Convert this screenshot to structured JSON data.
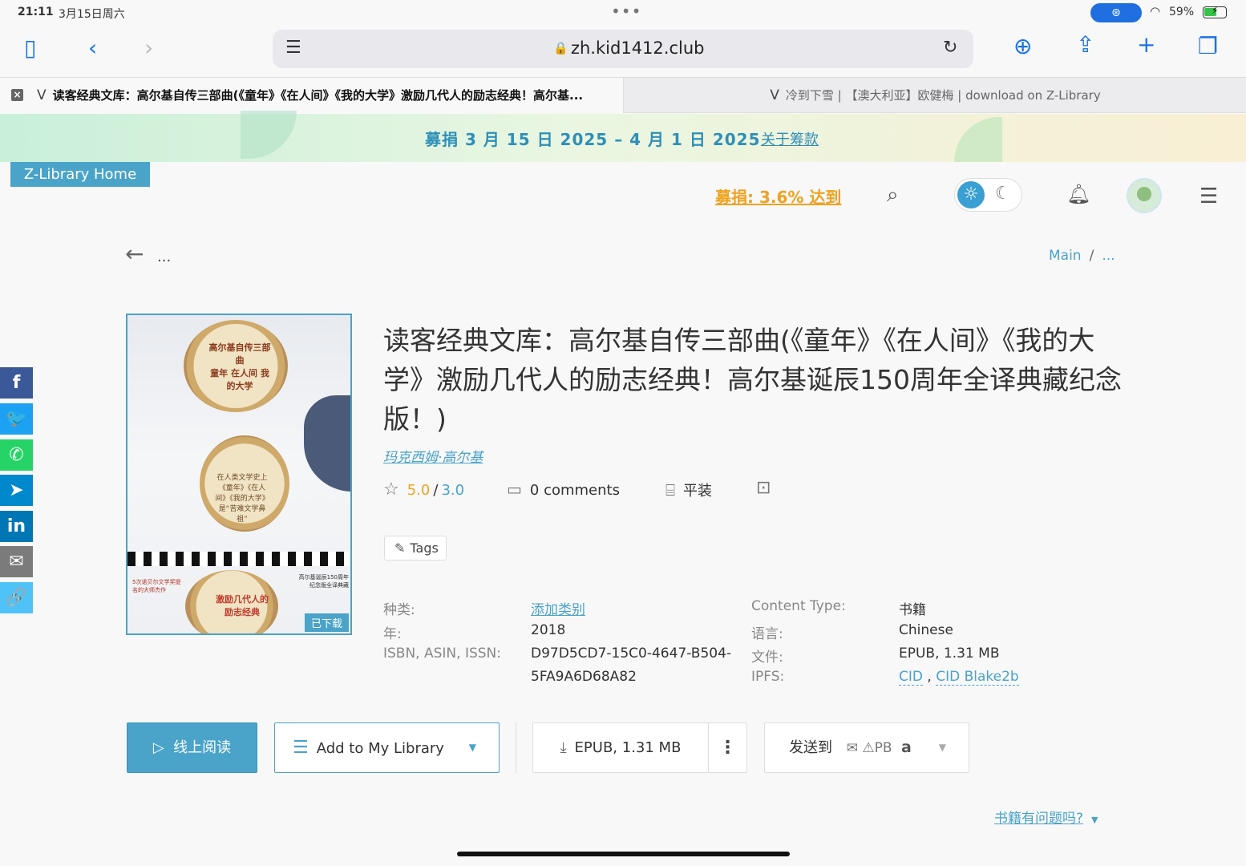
{
  "status_bar": {
    "time": "21:11",
    "date": "3月15日周六",
    "battery": "59%",
    "battery_level": 0.59
  },
  "browser": {
    "url": "zh.kid1412.club",
    "tabs": [
      {
        "favicon": "V",
        "title": "读客经典文库：高尔基自传三部曲(《童年》《在人间》《我的大学》激励几代人的励志经典！高尔基...",
        "active": true
      },
      {
        "favicon": "V",
        "title": "冷到下雪 | 【澳大利亚】欧健梅 | download on Z-Library",
        "active": false
      }
    ]
  },
  "banner": {
    "dates": "募捐 3 月 15 日 2025 – 4 月 1 日 2025",
    "about_link": "关于筹款"
  },
  "header": {
    "home_label": "Z-Library Home",
    "donation_progress": "募捐: 3.6% 达到"
  },
  "nav": {
    "back_dots": "...",
    "breadcrumb": [
      "Main",
      "..."
    ]
  },
  "social": [
    {
      "name": "facebook",
      "color": "#3b5998",
      "glyph": "f"
    },
    {
      "name": "twitter",
      "color": "#1da1f2",
      "glyph": "🐦"
    },
    {
      "name": "whatsapp",
      "color": "#25d366",
      "glyph": "✆"
    },
    {
      "name": "telegram",
      "color": "#0088cc",
      "glyph": "➤"
    },
    {
      "name": "linkedin",
      "color": "#0077b5",
      "glyph": "in"
    },
    {
      "name": "email",
      "color": "#7b7b7b",
      "glyph": "✉"
    },
    {
      "name": "copy-link",
      "color": "#4fc3f7",
      "glyph": "🔗"
    }
  ],
  "book": {
    "title": "读客经典文库：高尔基自传三部曲(《童年》《在人间》《我的大学》激励几代人的励志经典！高尔基诞辰150周年全译典藏纪念版！)",
    "author": "玛克西姆·高尔基",
    "rating_user": "5.0",
    "rating_sep": "/",
    "rating_quality": "3.0",
    "comments": "0 comments",
    "binding": "平装",
    "tags_label": "Tags",
    "cover": {
      "line1": "高尔基自传三部曲",
      "line2": "童年 在人间 我的大学",
      "mid": "在人类文学史上《童年》《在人间》《我的大学》是“苦难文学鼻祖”",
      "bottom": "激励几代人的励志经典",
      "side_left": "5次诺贝尔文学奖提名的大师杰作",
      "side_right": "高尔基诞辰150周年纪念版全译典藏",
      "badge": "已下载"
    }
  },
  "properties": {
    "category_label": "种类:",
    "category_value": "添加类别",
    "year_label": "年:",
    "year_value": "2018",
    "isbn_label": "ISBN, ASIN, ISSN:",
    "isbn_value_line1": "D97D5CD7-15C0-4647-B504-",
    "isbn_value_line2": "5FA9A6D68A82",
    "content_type_label": "Content Type:",
    "content_type_value": "书籍",
    "language_label": "语言:",
    "language_value": "Chinese",
    "file_label": "文件:",
    "file_value": "EPUB, 1.31 MB",
    "ipfs_label": "IPFS:",
    "ipfs_cid": "CID",
    "ipfs_sep": ",",
    "ipfs_blake": "CID Blake2b"
  },
  "actions": {
    "read_online": "线上阅读",
    "add_library": "Add to My Library",
    "download": "EPUB, 1.31 MB",
    "send_to": "发送到",
    "send_targets": "PB",
    "report_problem": "书籍有问题吗?"
  }
}
